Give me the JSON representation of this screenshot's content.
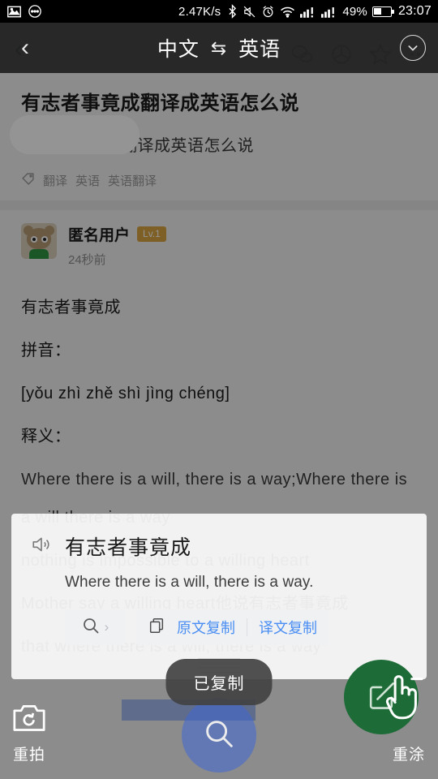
{
  "status_bar": {
    "network_speed": "2.47K/s",
    "battery_percent": "49%",
    "time": "23:07",
    "icons": [
      "image-icon",
      "message-dots-icon",
      "bluetooth-icon",
      "mute-icon",
      "alarm-icon",
      "wifi-icon",
      "signal-1-icon",
      "signal-2-icon",
      "battery-icon"
    ]
  },
  "translate_header": {
    "back_label": "‹",
    "source_language": "中文",
    "swap_symbol": "⇆",
    "target_language": "英语",
    "more_icon": "chevron-down-icon"
  },
  "background_app": {
    "back_label": "‹",
    "top_icons": [
      "comment-icon",
      "moments-icon",
      "star-icon",
      "more-dots-icon"
    ],
    "question": {
      "title": "有志者事竟成翻译成英语怎么说",
      "subtitle": "有志者事竟成翻译成英语怎么说",
      "tag_icon": "tag-icon",
      "tags": [
        "翻译",
        "英语",
        "英语翻译"
      ]
    },
    "answer": {
      "avatar": "anonymous-avatar",
      "user_name": "匿名用户",
      "user_level": "Lv.1",
      "time": "24秒前",
      "lines": [
        "有志者事竟成",
        "拼音：",
        "[yǒu zhì zhě shì jìng chéng]",
        "释义："
      ],
      "hidden_lines": [
        "Where there is a will, there is a way;Where there is a will there is a way",
        "nothing is impossible to a willing heart",
        "Mother say a willing heart他说有志者事竟成",
        "that where there is a will, there is a way"
      ]
    }
  },
  "translation_card": {
    "speaker_icon": "speaker-icon",
    "source_text": "有志者事竟成",
    "translated_text": "Where there is a will, there is a way.",
    "search_icon": "search-icon",
    "search_chevron": "›",
    "copy_icon": "copy-icon",
    "copy_source_label": "原文复制",
    "copy_target_label": "译文复制",
    "drag_handle": "drag-handle",
    "accent_color": "#4a8ef3"
  },
  "toast": {
    "message": "已复制"
  },
  "bottom_tools": {
    "retake_icon": "camera-retake-icon",
    "retake_label": "重拍",
    "repaint_icon": "edit-square-icon",
    "repaint_label": "重涂",
    "search_fab_icon": "magnifier-icon",
    "cursor_icon": "pointing-hand-icon",
    "green_color": "#1d6b36",
    "blue_color": "#3e68d6"
  }
}
